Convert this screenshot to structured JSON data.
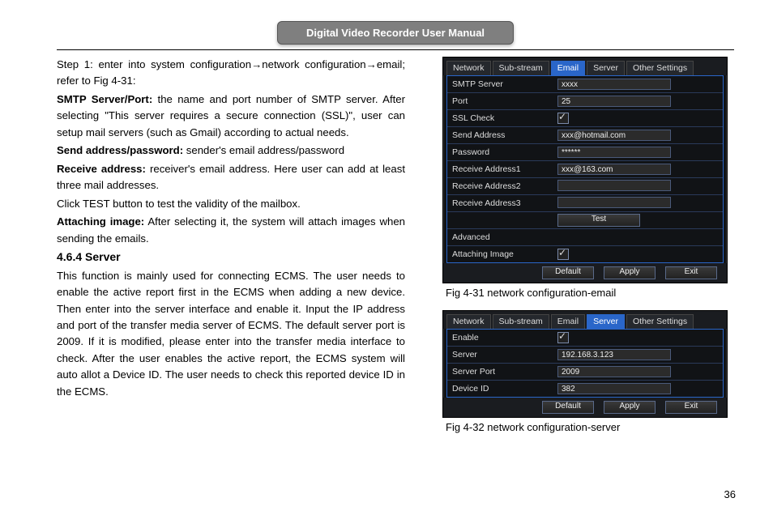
{
  "header": {
    "title": "Digital Video Recorder User Manual"
  },
  "page_number": "36",
  "body": {
    "step_line": "Step 1: enter into system configuration→network configuration→email; refer to Fig 4-31:",
    "smtp_bold": "SMTP Server/Port:",
    "smtp_text": " the name and port number of SMTP server. After selecting \"This server requires a secure connection (SSL)\", user can setup mail servers (such as Gmail) according to actual needs.",
    "send_bold": "Send address/password:",
    "send_text": " sender's email address/password",
    "recv_bold": "Receive address:",
    "recv_text": " receiver's email address. Here user can add at least three mail addresses.",
    "test_line": "Click TEST button to test the validity of the mailbox.",
    "attach_bold": "Attaching image:",
    "attach_text": " After selecting it, the system will attach images when sending the emails.",
    "h464": "4.6.4  Server",
    "server_para": "This function is mainly used for connecting ECMS. The user needs to enable the active report first in the ECMS when adding a new device. Then enter into the server interface and enable it. Input the IP address and port of the transfer media server of ECMS. The default server port is 2009. If it is modified, please enter into the transfer media interface to check. After the user enables the active report, the ECMS system will auto allot a Device ID. The user needs to check this reported device ID in the ECMS."
  },
  "figs": {
    "fig431": "Fig 4-31 network configuration-email",
    "fig432": "Fig 4-32 network configuration-server"
  },
  "tabs": {
    "network": "Network",
    "substream": "Sub-stream",
    "email": "Email",
    "server": "Server",
    "other": "Other Settings"
  },
  "email_panel": {
    "rows": {
      "smtp_server": "SMTP Server",
      "port": "Port",
      "ssl_check": "SSL Check",
      "send_address": "Send Address",
      "password": "Password",
      "recv1": "Receive Address1",
      "recv2": "Receive Address2",
      "recv3": "Receive Address3",
      "advanced": "Advanced",
      "attaching": "Attaching Image"
    },
    "vals": {
      "smtp_server": "xxxx",
      "port": "25",
      "send_address": "xxx@hotmail.com",
      "password": "******",
      "recv1": "xxx@163.com"
    },
    "test_btn": "Test"
  },
  "server_panel": {
    "rows": {
      "enable": "Enable",
      "server": "Server",
      "server_port": "Server Port",
      "device_id": "Device ID"
    },
    "vals": {
      "server": "192.168.3.123",
      "server_port": "2009",
      "device_id": "382"
    }
  },
  "buttons": {
    "default": "Default",
    "apply": "Apply",
    "exit": "Exit"
  }
}
